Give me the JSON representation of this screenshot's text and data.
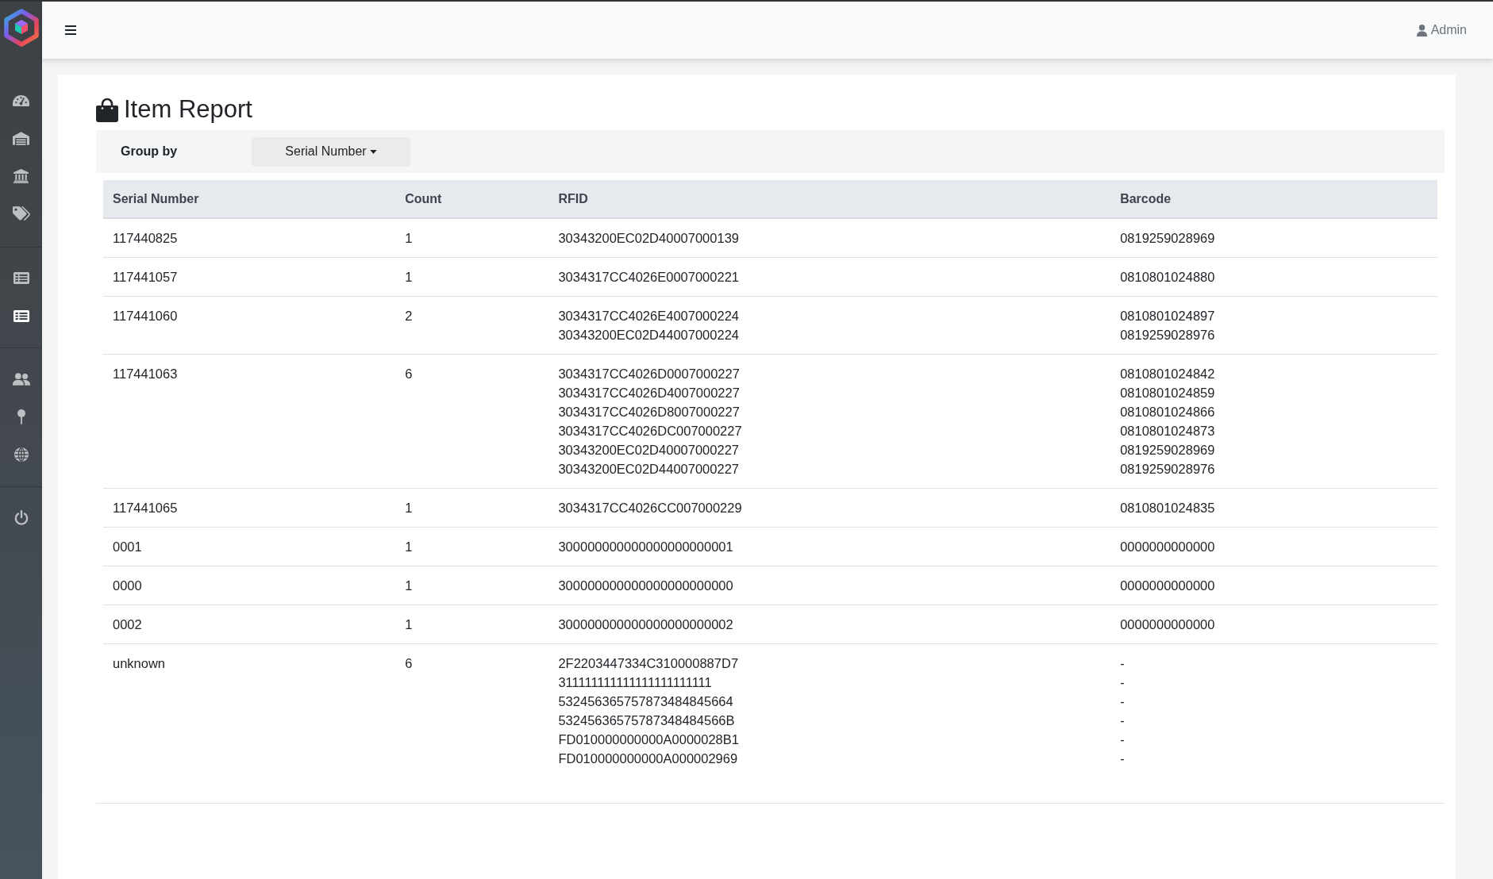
{
  "sidebar": {
    "groups": [
      {
        "items": [
          {
            "selected": false
          },
          {
            "selected": false
          },
          {
            "selected": false
          },
          {
            "selected": false
          }
        ]
      },
      {
        "items": [
          {
            "selected": false
          },
          {
            "selected": true
          }
        ]
      },
      {
        "items": [
          {
            "selected": false
          },
          {
            "selected": false
          },
          {
            "selected": false
          }
        ]
      },
      {
        "items": [
          {
            "selected": false
          }
        ]
      }
    ]
  },
  "header": {
    "user": "Admin"
  },
  "page": {
    "title": "Item Report",
    "group_by": {
      "label": "Group by",
      "value": "Serial Number"
    }
  },
  "table": {
    "columns": [
      "Serial Number",
      "Count",
      "RFID",
      "Barcode"
    ],
    "rows": [
      {
        "serial_number": "117440825",
        "count": "1",
        "rfid": [
          "30343200EC02D40007000139"
        ],
        "barcode": [
          "0819259028969"
        ]
      },
      {
        "serial_number": "117441057",
        "count": "1",
        "rfid": [
          "3034317CC4026E0007000221"
        ],
        "barcode": [
          "0810801024880"
        ]
      },
      {
        "serial_number": "117441060",
        "count": "2",
        "rfid": [
          "3034317CC4026E4007000224",
          "30343200EC02D44007000224"
        ],
        "barcode": [
          "0810801024897",
          "0819259028976"
        ]
      },
      {
        "serial_number": "117441063",
        "count": "6",
        "rfid": [
          "3034317CC4026D0007000227",
          "3034317CC4026D4007000227",
          "3034317CC4026D8007000227",
          "3034317CC4026DC007000227",
          "30343200EC02D40007000227",
          "30343200EC02D44007000227"
        ],
        "barcode": [
          "0810801024842",
          "0810801024859",
          "0810801024866",
          "0810801024873",
          "0819259028969",
          "0819259028976"
        ]
      },
      {
        "serial_number": "117441065",
        "count": "1",
        "rfid": [
          "3034317CC4026CC007000229"
        ],
        "barcode": [
          "0810801024835"
        ]
      },
      {
        "serial_number": "0001",
        "count": "1",
        "rfid": [
          "300000000000000000000001"
        ],
        "barcode": [
          "0000000000000"
        ]
      },
      {
        "serial_number": "0000",
        "count": "1",
        "rfid": [
          "300000000000000000000000"
        ],
        "barcode": [
          "0000000000000"
        ]
      },
      {
        "serial_number": "0002",
        "count": "1",
        "rfid": [
          "300000000000000000000002"
        ],
        "barcode": [
          "0000000000000"
        ]
      },
      {
        "serial_number": "unknown",
        "count": "6",
        "rfid": [
          "2F2203447334C310000887D7",
          "311111111111111111111111",
          "532456365757873484845664",
          "53245636575787348484566B",
          "FD010000000000A0000028B1",
          "FD010000000000A000002969"
        ],
        "barcode": [
          "-",
          "-",
          "-",
          "-",
          "-",
          "-"
        ]
      }
    ]
  }
}
